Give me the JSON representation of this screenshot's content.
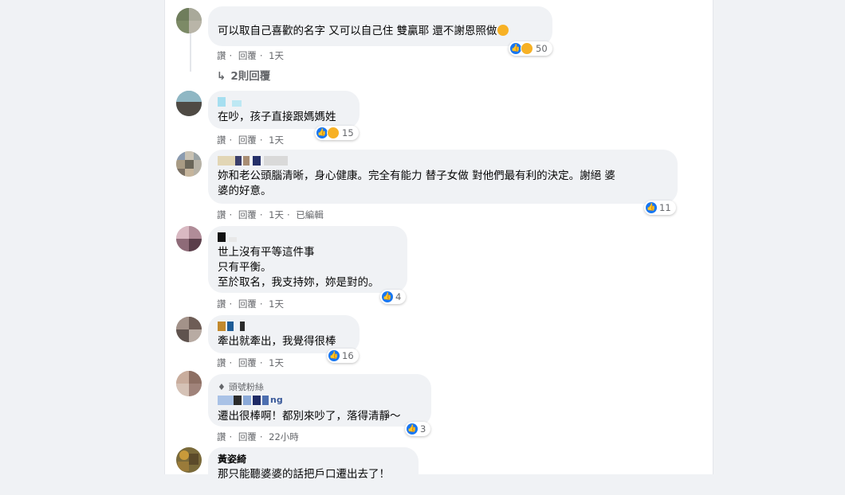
{
  "actions": {
    "like": "讚",
    "reply": "回覆",
    "dot": "·"
  },
  "comments": [
    {
      "text": "可以取自己喜歡的名字 又可以自己住 雙贏耶 還不謝恩照做",
      "time": "1天",
      "reactions": "50"
    },
    {
      "text": "在吵，孩子直接跟媽媽姓",
      "time": "1天",
      "reactions": "15"
    },
    {
      "text": "妳和老公頭腦清晰，身心健康。完全有能力 替子女做 對他們最有利的決定。謝絕 婆\n婆的好意。",
      "time": "1天",
      "edited": "已編輯",
      "reactions": "11"
    },
    {
      "text": "世上沒有平等這件事\n只有平衡。\n至於取名，我支持妳，妳是對的。",
      "time": "1天",
      "reactions": "4"
    },
    {
      "text": "牽出就牽出，我覺得很棒",
      "time": "1天",
      "reactions": "16"
    },
    {
      "badge": "頭號粉絲",
      "name_fragment": "ng",
      "text": "遷出很棒啊！都別來吵了，落得清靜～",
      "time": "22小時",
      "reactions": "3"
    },
    {
      "name": "黃姿綺",
      "text": "那只能聽婆婆的話把戶口遷出去了！"
    }
  ],
  "replies_link": "2則回覆",
  "icons": {
    "reply_arrow": "reply-arrow-icon",
    "like": "thumbs-up-icon",
    "haha": "haha-emoji-icon",
    "diamond": "diamond-icon"
  },
  "colors": {
    "bubble": "#f0f2f5",
    "meta": "#65676b",
    "like": "#1877f2",
    "haha": "#f7b125",
    "page_bg": "#f0f2f5"
  }
}
